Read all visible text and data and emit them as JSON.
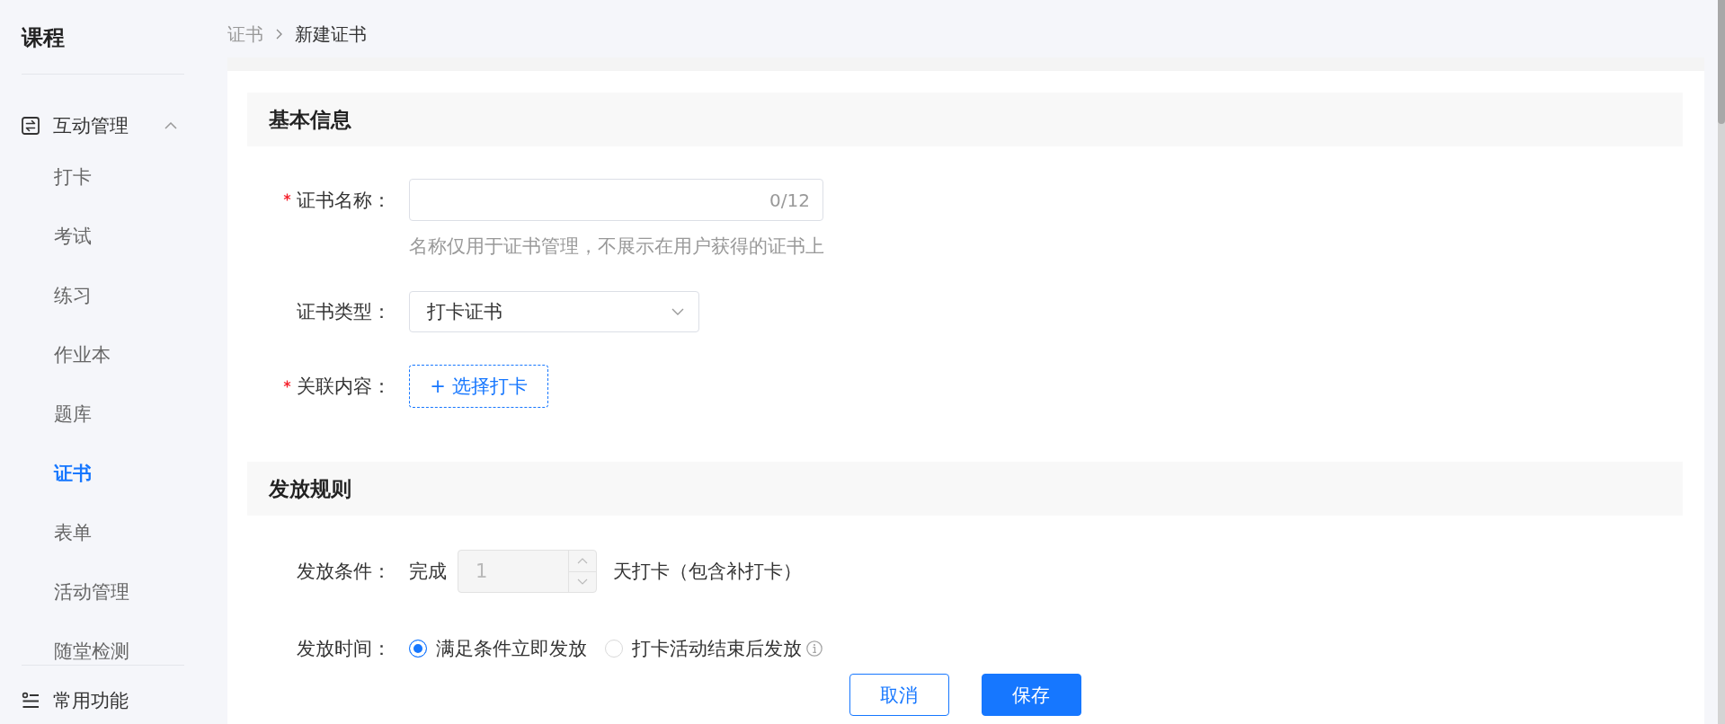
{
  "sidebar": {
    "title": "课程",
    "groups": [
      {
        "label": "互动管理",
        "expanded": true,
        "items": [
          {
            "label": "打卡",
            "selected": false
          },
          {
            "label": "考试",
            "selected": false
          },
          {
            "label": "练习",
            "selected": false
          },
          {
            "label": "作业本",
            "selected": false
          },
          {
            "label": "题库",
            "selected": false
          },
          {
            "label": "证书",
            "selected": true
          },
          {
            "label": "表单",
            "selected": false
          },
          {
            "label": "活动管理",
            "selected": false
          },
          {
            "label": "随堂检测",
            "selected": false
          }
        ]
      }
    ],
    "footer": {
      "label": "常用功能"
    }
  },
  "breadcrumb": [
    "证书",
    "新建证书"
  ],
  "sections": [
    {
      "title": "基本信息",
      "fields": [
        {
          "kind": "text",
          "label": "证书名称：",
          "required": true,
          "counter": "0/12",
          "hint": "名称仅用于证书管理，不展示在用户获得的证书上"
        },
        {
          "kind": "select",
          "label": "证书类型：",
          "required": false,
          "value": "打卡证书"
        },
        {
          "kind": "picker",
          "label": "关联内容：",
          "required": true,
          "button": "+ 选择打卡"
        }
      ]
    },
    {
      "title": "发放规则",
      "fields": [
        {
          "kind": "number",
          "label": "发放条件：",
          "required": false,
          "prefix": "完成",
          "value": "1",
          "disabled": true,
          "suffix": "天打卡（包含补打卡）"
        },
        {
          "kind": "radio",
          "label": "发放时间：",
          "required": false,
          "options": [
            {
              "label": "满足条件立即发放",
              "selected": true,
              "info": false
            },
            {
              "label": "打卡活动结束后发放",
              "selected": false,
              "info": true
            }
          ]
        }
      ]
    }
  ],
  "buttons": [
    {
      "label": "取消",
      "kind": "cancel"
    },
    {
      "label": "保存",
      "kind": "save"
    }
  ]
}
